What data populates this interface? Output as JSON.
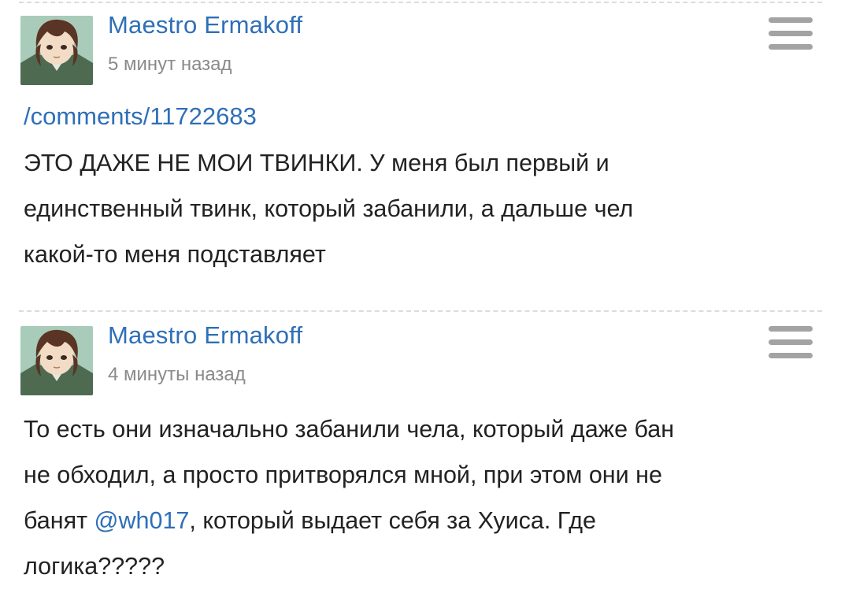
{
  "comments": [
    {
      "author": "Maestro Ermakoff",
      "time": "5 минут назад",
      "link": "/comments/11722683",
      "lines": [
        "ЭТО ДАЖЕ НЕ МОИ ТВИНКИ. У меня был первый и",
        "единственный твинк, который забанили, а дальше чел",
        "какой-то меня подставляет"
      ]
    },
    {
      "author": "Maestro Ermakoff",
      "time": "4 минуты назад",
      "line1": "То есть они изначально забанили чела, который даже бан",
      "line2": "не обходил, а просто притворялся мной, при этом они не",
      "line3_before": "банят ",
      "mention": "@wh017",
      "line3_after": ", который выдает себя за Хуиса. Где",
      "line4": "логика?????"
    }
  ],
  "colors": {
    "link": "#2f6fb7",
    "text": "#222222",
    "muted": "#8a8a8a",
    "menu": "#a3a3a3"
  },
  "icons": {
    "avatar": "avatar-anime-portrait",
    "menu": "hamburger-menu-icon"
  }
}
